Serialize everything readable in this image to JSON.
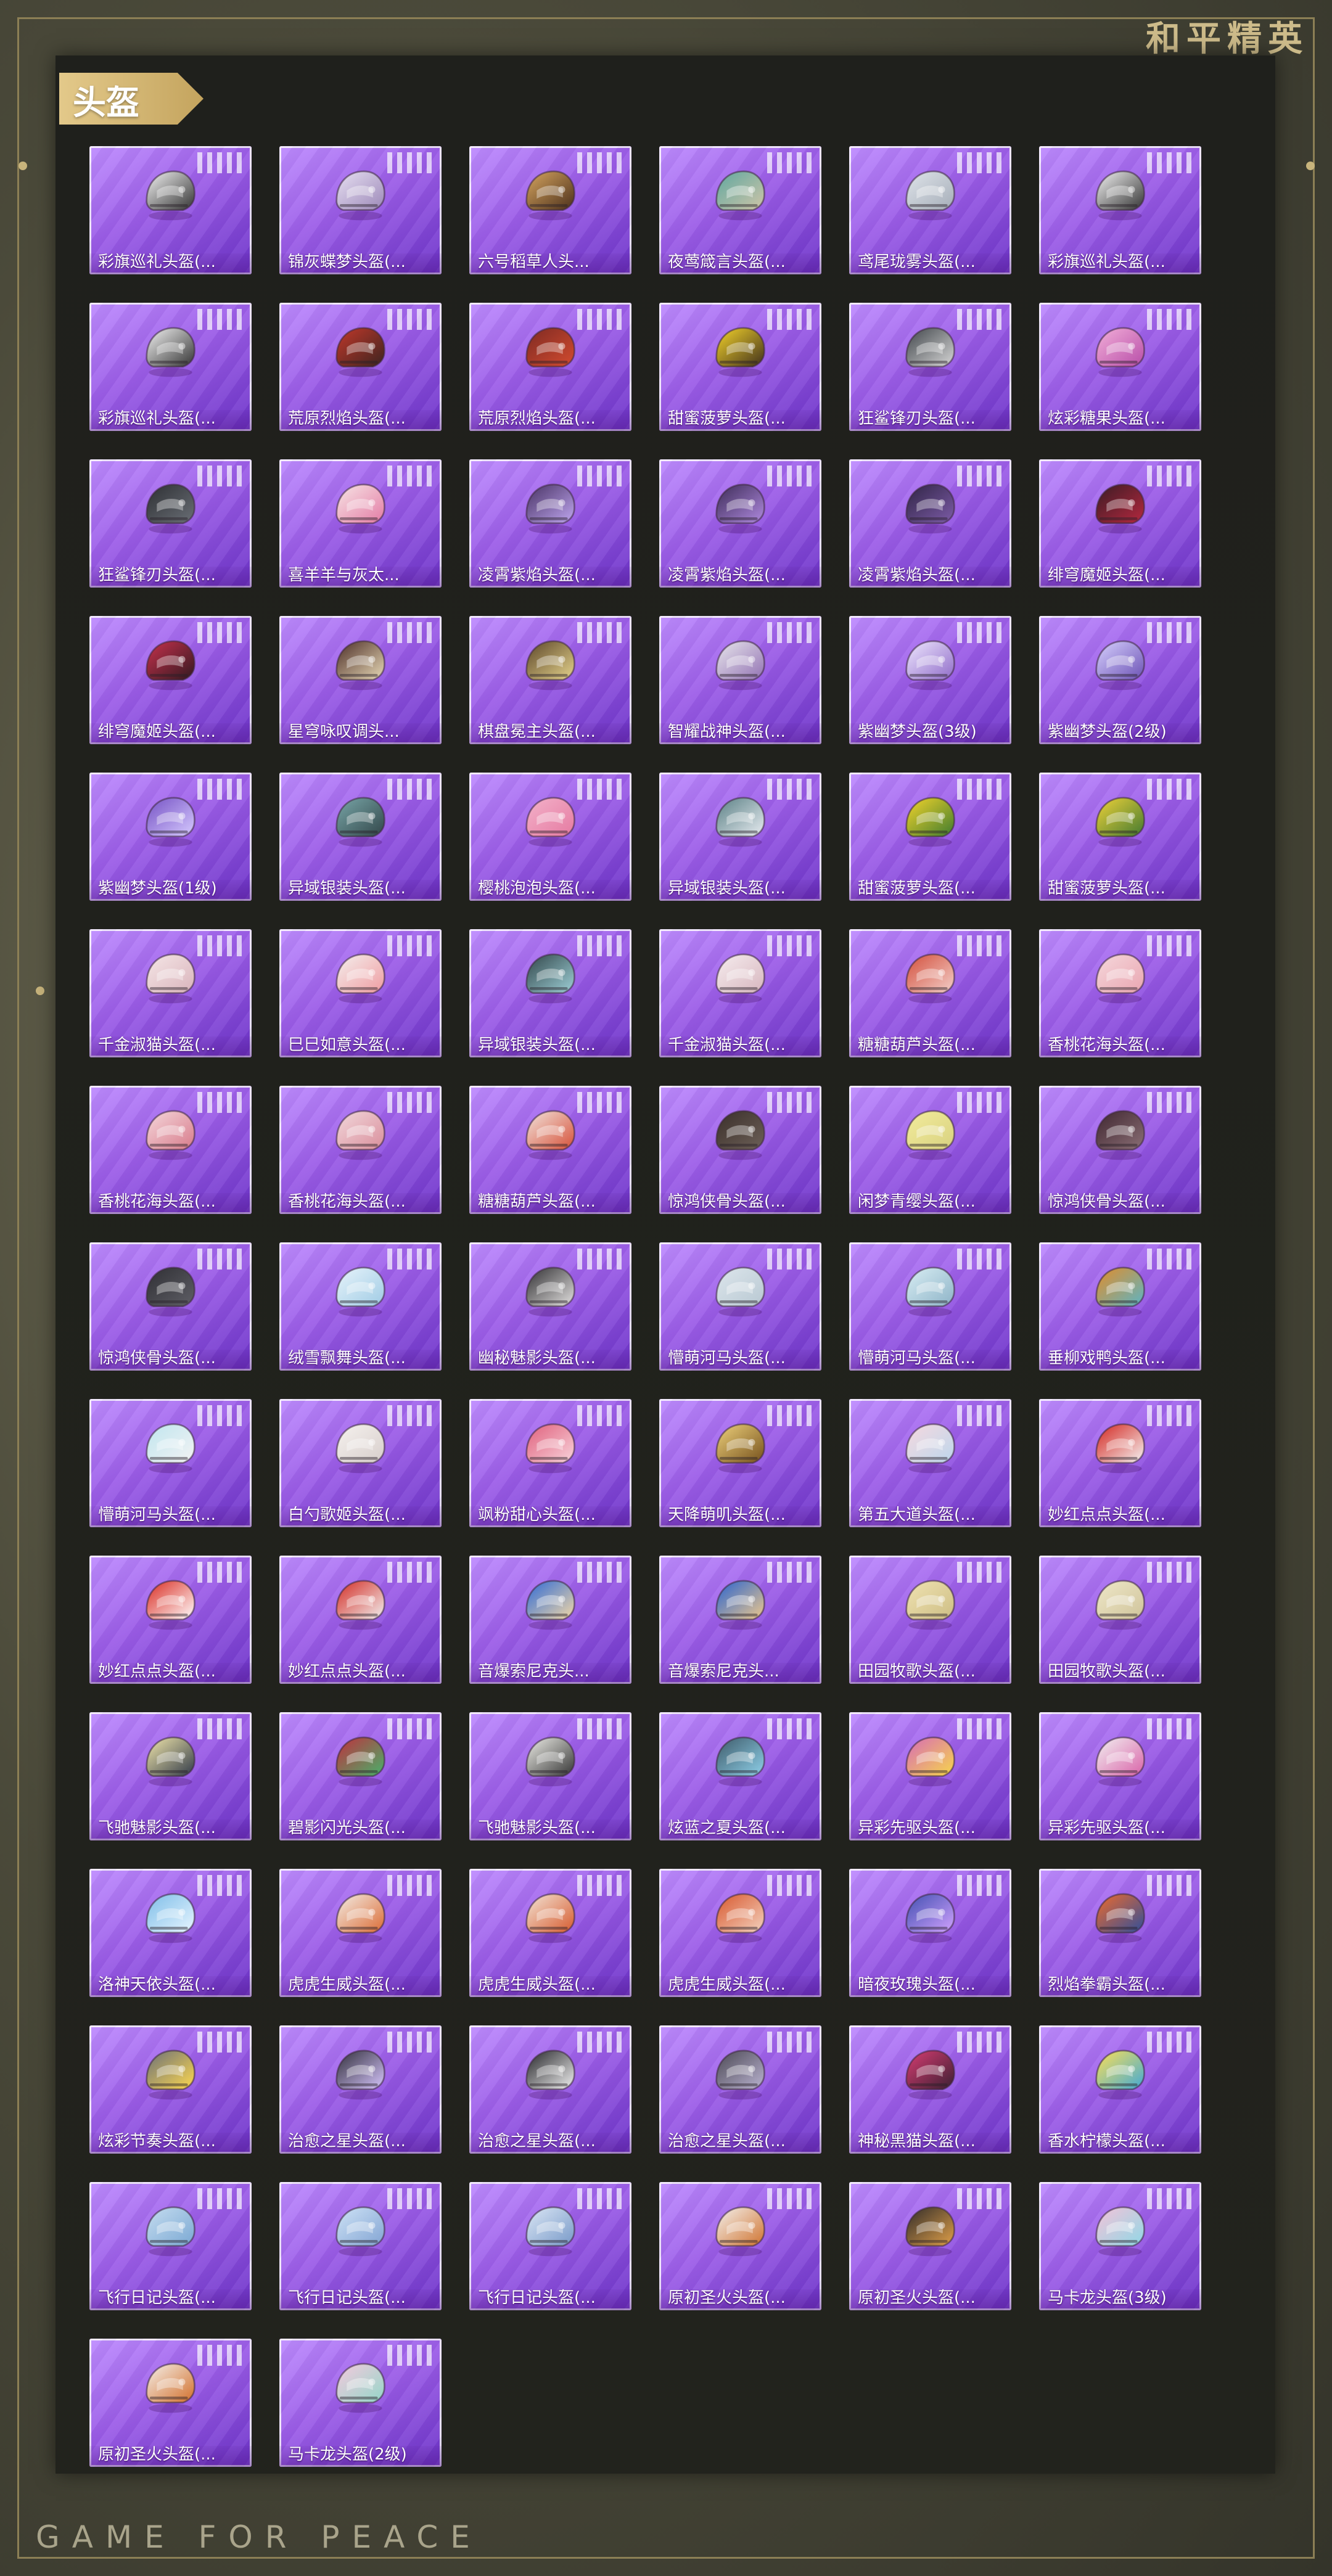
{
  "brand": "和平精英",
  "footer": "GAME FOR PEACE",
  "section_title": "头盔",
  "items": [
    {
      "label": "彩旗巡礼头盔(...",
      "colors": [
        "#f5f5f5",
        "#333333"
      ]
    },
    {
      "label": "锦灰蝶梦头盔(...",
      "colors": [
        "#e7e0f2",
        "#9c88b8"
      ]
    },
    {
      "label": "六号稻草人头...",
      "colors": [
        "#d7a660",
        "#4b2f1b"
      ]
    },
    {
      "label": "夜莺箴言头盔(...",
      "colors": [
        "#5ea7a0",
        "#d0c5a8"
      ]
    },
    {
      "label": "鸢尾珑雾头盔(...",
      "colors": [
        "#dfe4ea",
        "#a5adb8"
      ]
    },
    {
      "label": "彩旗巡礼头盔(...",
      "colors": [
        "#f5f5f5",
        "#333333"
      ]
    },
    {
      "label": "彩旗巡礼头盔(...",
      "colors": [
        "#f5f5f5",
        "#333333"
      ]
    },
    {
      "label": "荒原烈焰头盔(...",
      "colors": [
        "#c3382a",
        "#3b2420"
      ]
    },
    {
      "label": "荒原烈焰头盔(...",
      "colors": [
        "#7d2a23",
        "#d34b2f"
      ]
    },
    {
      "label": "甜蜜菠萝头盔(...",
      "colors": [
        "#f6d52a",
        "#3f2f1c"
      ]
    },
    {
      "label": "狂鲨锋刃头盔(...",
      "colors": [
        "#3f4449",
        "#d8d8d8"
      ]
    },
    {
      "label": "炫彩糖果头盔(...",
      "colors": [
        "#f3b0d9",
        "#b74da8"
      ]
    },
    {
      "label": "狂鲨锋刃头盔(...",
      "colors": [
        "#2d2f33",
        "#6a6f76"
      ]
    },
    {
      "label": "喜羊羊与灰太...",
      "colors": [
        "#f7e6e6",
        "#e37aa4"
      ]
    },
    {
      "label": "凌霄紫焰头盔(...",
      "colors": [
        "#473162",
        "#c0a7f1"
      ]
    },
    {
      "label": "凌霄紫焰头盔(...",
      "colors": [
        "#3c2b56",
        "#b08ae0"
      ]
    },
    {
      "label": "凌霄紫焰头盔(...",
      "colors": [
        "#2f2444",
        "#7d5ca8"
      ]
    },
    {
      "label": "绯穹魔姬头盔(...",
      "colors": [
        "#3a1c24",
        "#b5283f"
      ]
    },
    {
      "label": "绯穹魔姬头盔(...",
      "colors": [
        "#c8314d",
        "#31191f"
      ]
    },
    {
      "label": "星穹咏叹调头...",
      "colors": [
        "#4b2c26",
        "#e9dbb8"
      ]
    },
    {
      "label": "棋盘冕主头盔(...",
      "colors": [
        "#5b4528",
        "#e6d48d"
      ]
    },
    {
      "label": "智耀战神头盔(...",
      "colors": [
        "#e8e7ec",
        "#9271b3"
      ]
    },
    {
      "label": "紫幽梦头盔(3级)",
      "colors": [
        "#efe8ff",
        "#8f6bc8"
      ]
    },
    {
      "label": "紫幽梦头盔(2级)",
      "colors": [
        "#d8d2ff",
        "#6b51b4"
      ]
    },
    {
      "label": "紫幽梦头盔(1级)",
      "colors": [
        "#7450c4",
        "#d7cbff"
      ]
    },
    {
      "label": "异域银装头盔(...",
      "colors": [
        "#79a7a9",
        "#324649"
      ]
    },
    {
      "label": "樱桃泡泡头盔(...",
      "colors": [
        "#f3b2ca",
        "#e57aa1"
      ]
    },
    {
      "label": "异域银装头盔(...",
      "colors": [
        "#597f84",
        "#e9edf2"
      ]
    },
    {
      "label": "甜蜜菠萝头盔(...",
      "colors": [
        "#f6d52a",
        "#3e7b2f"
      ]
    },
    {
      "label": "甜蜜菠萝头盔(...",
      "colors": [
        "#f1d338",
        "#427931"
      ]
    },
    {
      "label": "千金淑猫头盔(...",
      "colors": [
        "#f5e7e7",
        "#d9b3bb"
      ]
    },
    {
      "label": "巳巳如意头盔(...",
      "colors": [
        "#f4f0ee",
        "#ef9ba0"
      ]
    },
    {
      "label": "异域银装头盔(...",
      "colors": [
        "#304448",
        "#9fd1d8"
      ]
    },
    {
      "label": "千金淑猫头盔(...",
      "colors": [
        "#f6edef",
        "#d7b6be"
      ]
    },
    {
      "label": "糖糖葫芦头盔(...",
      "colors": [
        "#d34e3a",
        "#f3d0cb"
      ]
    },
    {
      "label": "香桃花海头盔(...",
      "colors": [
        "#f5d8dc",
        "#e9a5b0"
      ]
    },
    {
      "label": "香桃花海头盔(...",
      "colors": [
        "#f5d8dc",
        "#d77a8a"
      ]
    },
    {
      "label": "香桃花海头盔(...",
      "colors": [
        "#f2d8dc",
        "#d98e9b"
      ]
    },
    {
      "label": "糖糖葫芦头盔(...",
      "colors": [
        "#f2e4dd",
        "#d65038"
      ]
    },
    {
      "label": "惊鸿侠骨头盔(...",
      "colors": [
        "#3a2f2a",
        "#6d6058"
      ]
    },
    {
      "label": "闲梦青缨头盔(...",
      "colors": [
        "#f3ec9c",
        "#d8d180"
      ]
    },
    {
      "label": "惊鸿侠骨头盔(...",
      "colors": [
        "#3f2630",
        "#8b6f76"
      ]
    },
    {
      "label": "惊鸿侠骨头盔(...",
      "colors": [
        "#2f2f34",
        "#5f5f66"
      ]
    },
    {
      "label": "绒雪飘舞头盔(...",
      "colors": [
        "#e8f4fb",
        "#9fcbe4"
      ]
    },
    {
      "label": "幽秘魅影头盔(...",
      "colors": [
        "#2f2e31",
        "#e4e2e1"
      ]
    },
    {
      "label": "懵萌河马头盔(...",
      "colors": [
        "#dde6ec",
        "#b8c8d2"
      ]
    },
    {
      "label": "懵萌河马头盔(...",
      "colors": [
        "#d9eef4",
        "#8db3c7"
      ]
    },
    {
      "label": "垂柳戏鸭头盔(...",
      "colors": [
        "#e48c28",
        "#5bb5c6"
      ]
    },
    {
      "label": "懵萌河马头盔(...",
      "colors": [
        "#bfe5ef",
        "#f3f3f3"
      ]
    },
    {
      "label": "白勺歌姬头盔(...",
      "colors": [
        "#f6f2ef",
        "#d7cecb"
      ]
    },
    {
      "label": "飒粉甜心头盔(...",
      "colors": [
        "#e05f7b",
        "#f8d4dc"
      ]
    },
    {
      "label": "天降萌叽头盔(...",
      "colors": [
        "#efd27c",
        "#75501c"
      ]
    },
    {
      "label": "第五大道头盔(...",
      "colors": [
        "#f7d8df",
        "#bcd7ec"
      ]
    },
    {
      "label": "妙红点点头盔(...",
      "colors": [
        "#d3241d",
        "#f5f5f5"
      ]
    },
    {
      "label": "妙红点点头盔(...",
      "colors": [
        "#d92a20",
        "#ffffff"
      ]
    },
    {
      "label": "妙红点点头盔(...",
      "colors": [
        "#d32b23",
        "#f1f1f1"
      ]
    },
    {
      "label": "音爆索尼克头...",
      "colors": [
        "#2d69d7",
        "#f5d9a6"
      ]
    },
    {
      "label": "音爆索尼克头...",
      "colors": [
        "#2762d1",
        "#f0c98b"
      ]
    },
    {
      "label": "田园牧歌头盔(...",
      "colors": [
        "#f0e3b2",
        "#cdbd84"
      ]
    },
    {
      "label": "田园牧歌头盔(...",
      "colors": [
        "#efe8c9",
        "#cfc39a"
      ]
    },
    {
      "label": "飞驰魅影头盔(...",
      "colors": [
        "#f4e9ad",
        "#303948"
      ]
    },
    {
      "label": "碧影闪光头盔(...",
      "colors": [
        "#c22d3d",
        "#46b36b"
      ]
    },
    {
      "label": "飞驰魅影头盔(...",
      "colors": [
        "#f0f0ea",
        "#343434"
      ]
    },
    {
      "label": "炫蓝之夏头盔(...",
      "colors": [
        "#3d5968",
        "#8fd1ea"
      ]
    },
    {
      "label": "异彩先驱头盔(...",
      "colors": [
        "#d76ab8",
        "#f7d74a"
      ]
    },
    {
      "label": "异彩先驱头盔(...",
      "colors": [
        "#f2f2f2",
        "#d962a8"
      ]
    },
    {
      "label": "洛神天依头盔(...",
      "colors": [
        "#7dbde8",
        "#e8f6ff"
      ]
    },
    {
      "label": "虎虎生威头盔(...",
      "colors": [
        "#f3eee7",
        "#db6b34"
      ]
    },
    {
      "label": "虎虎生威头盔(...",
      "colors": [
        "#f3e5d7",
        "#d65a2d"
      ]
    },
    {
      "label": "虎虎生威头盔(...",
      "colors": [
        "#d8572d",
        "#f3d2bf"
      ]
    },
    {
      "label": "暗夜玫瑰头盔(...",
      "colors": [
        "#404fb0",
        "#d2a2ff"
      ]
    },
    {
      "label": "烈焰拳霸头盔(...",
      "colors": [
        "#f06a2a",
        "#2f4f9b"
      ]
    },
    {
      "label": "炫彩节奏头盔(...",
      "colors": [
        "#6a6f79",
        "#ffd94f"
      ]
    },
    {
      "label": "治愈之星头盔(...",
      "colors": [
        "#2f2d38",
        "#d8c7ff"
      ]
    },
    {
      "label": "治愈之星头盔(...",
      "colors": [
        "#222226",
        "#f3f3f3"
      ]
    },
    {
      "label": "治愈之星头盔(...",
      "colors": [
        "#4a4752",
        "#bbb4d2"
      ]
    },
    {
      "label": "神秘黑猫头盔(...",
      "colors": [
        "#d93c73",
        "#3a2031"
      ]
    },
    {
      "label": "香水柠檬头盔(...",
      "colors": [
        "#ffe054",
        "#41a9d7"
      ]
    },
    {
      "label": "飞行日记头盔(...",
      "colors": [
        "#c6ddf0",
        "#7aa8d3"
      ]
    },
    {
      "label": "飞行日记头盔(...",
      "colors": [
        "#cfe3f6",
        "#82a4d3"
      ]
    },
    {
      "label": "飞行日记头盔(...",
      "colors": [
        "#dce7f5",
        "#7799c8"
      ]
    },
    {
      "label": "原初圣火头盔(...",
      "colors": [
        "#f4f2ef",
        "#d0732f"
      ]
    },
    {
      "label": "原初圣火头盔(...",
      "colors": [
        "#2f2b2a",
        "#e1a049"
      ]
    },
    {
      "label": "马卡龙头盔(3级)",
      "colors": [
        "#f6c2d8",
        "#8fd8e6"
      ]
    },
    {
      "label": "原初圣火头盔(...",
      "colors": [
        "#f5f1ec",
        "#d26f2a"
      ]
    },
    {
      "label": "马卡龙头盔(2级)",
      "colors": [
        "#f6c9de",
        "#93d7c8"
      ]
    }
  ]
}
